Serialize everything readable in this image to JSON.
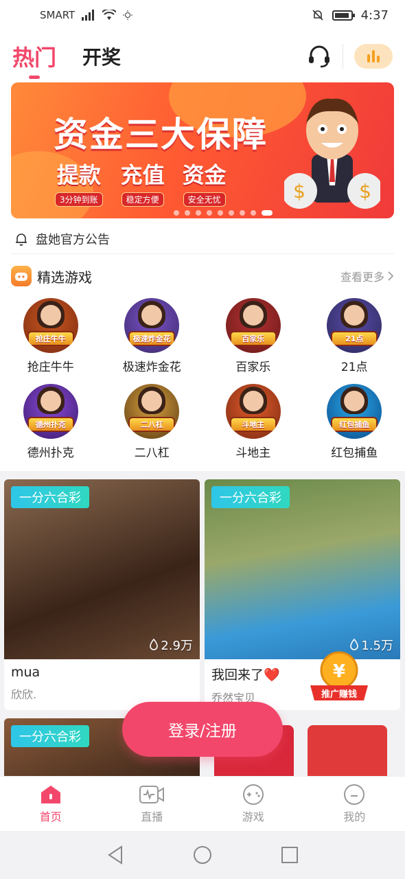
{
  "status_bar": {
    "carrier": "SMART",
    "time": "4:37"
  },
  "top_tabs": [
    {
      "label": "热门",
      "active": true
    },
    {
      "label": "开奖",
      "active": false
    }
  ],
  "banner": {
    "title": "资金三大保障",
    "items": [
      {
        "title": "提款",
        "sub": "3分钟到账"
      },
      {
        "title": "充值",
        "sub": "稳定方便"
      },
      {
        "title": "资金",
        "sub": "安全无忧"
      }
    ],
    "dot_count": 9,
    "active_dot": 8
  },
  "notice": {
    "text": "盘她官方公告"
  },
  "games_section": {
    "title": "精选游戏",
    "see_more": "查看更多",
    "games": [
      {
        "label": "抢庄牛牛",
        "badge": "抢庄牛牛",
        "colors": [
          "#7a2a12",
          "#c8561e"
        ]
      },
      {
        "label": "极速炸金花",
        "badge": "极速炸金花",
        "colors": [
          "#3a2a6a",
          "#7a52c8"
        ]
      },
      {
        "label": "百家乐",
        "badge": "百家乐",
        "colors": [
          "#6a1a1a",
          "#b23030"
        ]
      },
      {
        "label": "21点",
        "badge": "21点",
        "colors": [
          "#2a2a5a",
          "#5a4aa8"
        ]
      },
      {
        "label": "德州扑克",
        "badge": "德州扑克",
        "colors": [
          "#3a1a6a",
          "#8a4ad8"
        ]
      },
      {
        "label": "二八杠",
        "badge": "二八杠",
        "colors": [
          "#5a3a12",
          "#d8a040"
        ]
      },
      {
        "label": "斗地主",
        "badge": "斗地主",
        "colors": [
          "#7a2a12",
          "#e05a2a"
        ]
      },
      {
        "label": "红包捕鱼",
        "badge": "红包捕鱼",
        "colors": [
          "#0a4a8a",
          "#2aa8e8"
        ]
      }
    ]
  },
  "feed": [
    {
      "tag": "一分六合彩",
      "views": "2.9万",
      "title": "mua",
      "author": "欣欣.",
      "colors": [
        "#6b4a34",
        "#c9a88a"
      ]
    },
    {
      "tag": "一分六合彩",
      "views": "1.5万",
      "title": "我回来了❤️",
      "author": "乔然宝贝",
      "colors": [
        "#5f7a3a",
        "#4a9ac8"
      ]
    },
    {
      "tag": "一分六合彩",
      "colors": [
        "#3a2418",
        "#8a5a3a"
      ]
    },
    {
      "tag": "",
      "colors": [
        "#d8283a",
        "#e84a4a"
      ]
    }
  ],
  "promo": {
    "label": "推广赚钱"
  },
  "login_button": {
    "label": "登录/注册"
  },
  "bottom_nav": [
    {
      "label": "首页",
      "active": true
    },
    {
      "label": "直播",
      "active": false
    },
    {
      "label": "游戏",
      "active": false
    },
    {
      "label": "我的",
      "active": false
    }
  ],
  "colors": {
    "accent": "#f2476b",
    "tag": "#2fc6e8"
  }
}
